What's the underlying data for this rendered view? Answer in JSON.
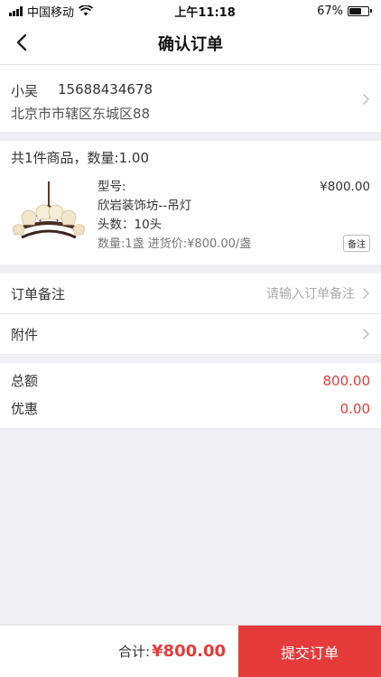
{
  "status": {
    "carrier": "中国移动",
    "time": "上午11:18",
    "battery": "67%",
    "battery_level": 0.67
  },
  "nav": {
    "title": "确认订单"
  },
  "address": {
    "name": "小吴",
    "phone": "15688434678",
    "detail": "北京市市辖区东城区88"
  },
  "goods": {
    "summary": "共1件商品，数量:1.00",
    "item": {
      "model_label": "型号:",
      "price": "¥800.00",
      "name": "欣岩装饰坊--吊灯",
      "heads": "头数：10头",
      "qty_info": "数量:1盏 进货价:¥800.00/盏",
      "remark_button": "备注"
    }
  },
  "order_note": {
    "label": "订单备注",
    "placeholder": "请输入订单备注"
  },
  "attachment": {
    "label": "附件"
  },
  "totals": {
    "total_label": "总额",
    "total_value": "800.00",
    "discount_label": "优惠",
    "discount_value": "0.00"
  },
  "bottom": {
    "sum_label": "合计:",
    "sum_value": "¥800.00",
    "submit_label": "提交订单"
  },
  "colors": {
    "accent": "#e63b3b"
  }
}
